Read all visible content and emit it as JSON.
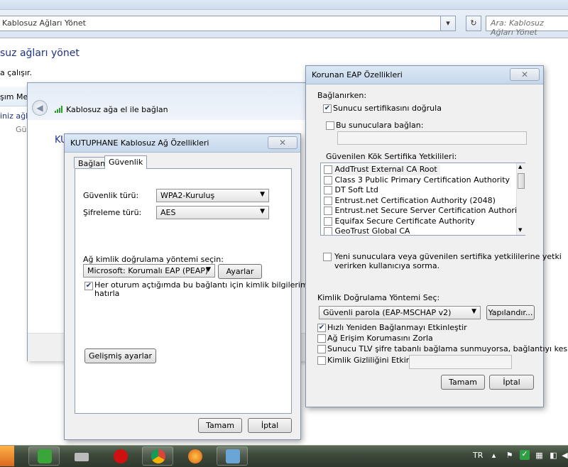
{
  "explorer": {
    "address": "Kablosuz Ağları Yönet",
    "search_placeholder": "Ara: Kablosuz Ağları Yönet",
    "heading": "suz ağları yönet",
    "subtext": "a çalışır.",
    "strip_text": "şım Merk",
    "list_line1": "iniz ağla",
    "list_line2": "Güv"
  },
  "wizard": {
    "title": "Kablosuz ağa el ile bağlan",
    "heading": "KU"
  },
  "kutuphane": {
    "title": "KUTUPHANE Kablosuz Ağ Özellikleri",
    "close_symbol": "✕",
    "tabs": [
      "Bağlantı",
      "Güvenlik"
    ],
    "active_tab": "Güvenlik",
    "security_type_label": "Güvenlik türü:",
    "security_type_value": "WPA2-Kuruluş",
    "encryption_label": "Şifreleme türü:",
    "encryption_value": "AES",
    "auth_method_label": "Ağ kimlik doğrulama yöntemi seçin:",
    "auth_method_value": "Microsoft: Korumalı EAP (PEAP)",
    "settings_button": "Ayarlar",
    "remember_line1": "Her oturum açtığımda bu bağlantı için kimlik bilgilerimi",
    "remember_line2": "hatırla",
    "remember_checked": true,
    "advanced_button": "Gelişmiş ayarlar",
    "ok_button": "Tamam",
    "cancel_button": "İptal"
  },
  "eap": {
    "title": "Korunan EAP Özellikleri",
    "close_symbol": "✕",
    "connecting_label": "Bağlanırken:",
    "validate_cert": "Sunucu sertifikasını doğrula",
    "validate_checked": true,
    "connect_servers": "Bu sunuculara bağlan:",
    "connect_checked": false,
    "trusted_root_label": "Güvenilen Kök Sertifika Yetkilileri:",
    "certificates": [
      "AddTrust External CA Root",
      "Class 3 Public Primary Certification Authority",
      "DT Soft Ltd",
      "Entrust.net Certification Authority (2048)",
      "Entrust.net Secure Server Certification Authority",
      "Equifax Secure Certificate Authority",
      "GeoTrust Global CA"
    ],
    "prompt_line1": "Yeni sunuculara veya güvenilen sertifika yetkililerine yetki",
    "prompt_line2": "verirken kullanıcıya sorma.",
    "auth_method_label": "Kimlik Doğrulama Yöntemi Seç:",
    "auth_method_value": "Güvenli parola (EAP-MSCHAP v2)",
    "configure_button": "Yapılandır...",
    "fast_reconnect": "Hızlı Yeniden Bağlanmayı Etkinleştir",
    "fast_reconnect_checked": true,
    "nap": "Ağ Erişim Korumasını Zorla",
    "tlv": "Sunucu TLV şifre tabanlı bağlama sunmuyorsa, bağlantıyı kes",
    "identity_privacy": "Kimlik Gizliliğini Etkinleştir",
    "ok_button": "Tamam",
    "cancel_button": "İptal"
  },
  "taskbar": {
    "language": "TR"
  }
}
